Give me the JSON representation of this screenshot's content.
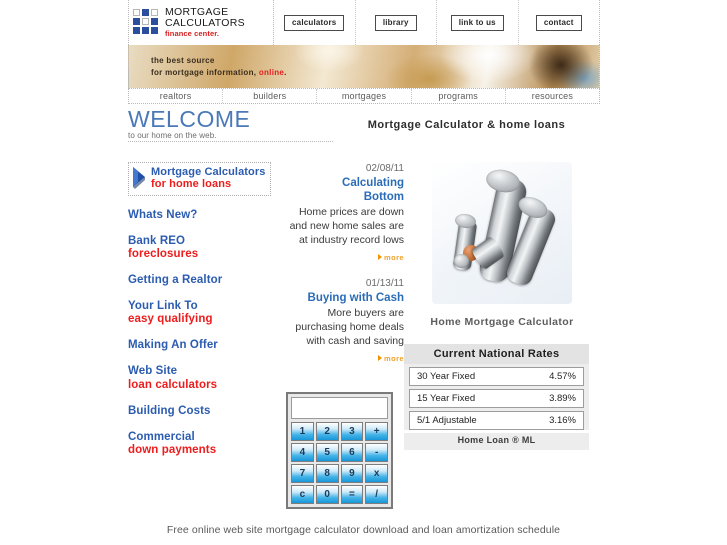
{
  "brand": {
    "line1": "MORTGAGE",
    "line2": "CALCULATORS",
    "tagline": "finance center."
  },
  "top_nav": [
    {
      "label": "calculators"
    },
    {
      "label": "library"
    },
    {
      "label": "link to us"
    },
    {
      "label": "contact"
    }
  ],
  "banner": {
    "line1": "the best source",
    "line2_a": "for mortgage information, ",
    "line2_b": "online",
    "line2_c": "."
  },
  "sub_nav": [
    {
      "label": "realtors"
    },
    {
      "label": "builders"
    },
    {
      "label": "mortgages"
    },
    {
      "label": "programs"
    },
    {
      "label": "resources"
    }
  ],
  "welcome": {
    "title": "WELCOME",
    "subtitle": "to our home on the web.",
    "page_heading": "Mortgage Calculator & home loans"
  },
  "sidebar": {
    "header": {
      "line1": "Mortgage Calculators",
      "line2": "for home loans"
    },
    "links": [
      {
        "line1": "Whats New?",
        "line2": ""
      },
      {
        "line1": "Bank REO",
        "line2": "foreclosures"
      },
      {
        "line1": "Getting a Realtor",
        "line2": ""
      },
      {
        "line1": "Your Link To",
        "line2": "easy qualifying"
      },
      {
        "line1": "Making An Offer",
        "line2": ""
      },
      {
        "line1": "Web Site",
        "line2": "loan calculators"
      },
      {
        "line1": "Building Costs",
        "line2": ""
      },
      {
        "line1": "Commercial",
        "line2": "down payments"
      }
    ]
  },
  "articles": [
    {
      "date": "02/08/11",
      "title_line1": "Calculating",
      "title_line2": "Bottom",
      "body": "Home prices are down and new home sales are at industry record lows",
      "more_label": "more"
    },
    {
      "date": "01/13/11",
      "title_line1": "Buying with Cash",
      "title_line2": "",
      "body": "More buyers are purchasing home deals with cash and saving",
      "more_label": "more"
    }
  ],
  "calculator": {
    "display_value": "",
    "keys": [
      "1",
      "2",
      "3",
      "+",
      "4",
      "5",
      "6",
      "-",
      "7",
      "8",
      "9",
      "x",
      "c",
      "0",
      "=",
      "/"
    ]
  },
  "promo": {
    "image_alt": "coin-stacks-photo",
    "caption": "Home Mortgage Calculator"
  },
  "rates": {
    "title": "Current National Rates",
    "rows": [
      {
        "term": "30 Year Fixed",
        "rate": "4.57%"
      },
      {
        "term": "15 Year Fixed",
        "rate": "3.89%"
      },
      {
        "term": "5/1 Adjustable",
        "rate": "3.16%"
      }
    ],
    "footer": "Home Loan ® ML"
  },
  "footer": {
    "text": "Free online web site mortgage calculator download and loan amortization schedule"
  },
  "colors": {
    "link_blue": "#2b5cb0",
    "link_red": "#ee1c1c",
    "welcome_blue": "#4b79b8",
    "more_orange": "#f0a22a",
    "brand_red": "#d81f1f",
    "logo_blue": "#2b4f9e"
  }
}
